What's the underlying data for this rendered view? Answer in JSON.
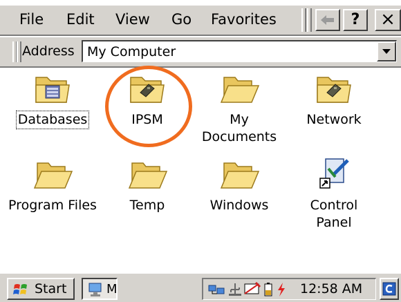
{
  "menu": {
    "file": "File",
    "edit": "Edit",
    "view": "View",
    "go": "Go",
    "favorites": "Favorites",
    "help": "?",
    "close": "×",
    "back_icon": "back-arrow-icon"
  },
  "address": {
    "label": "Address",
    "value": "My Computer"
  },
  "items": [
    {
      "label": "Databases",
      "icon": "folder-database-icon"
    },
    {
      "label": "IPSM",
      "icon": "folder-storage-card-icon"
    },
    {
      "label_line1": "My",
      "label_line2": "Documents",
      "icon": "folder-icon"
    },
    {
      "label": "Network",
      "icon": "folder-network-icon"
    },
    {
      "label": "Program Files",
      "icon": "folder-icon"
    },
    {
      "label": "Temp",
      "icon": "folder-icon"
    },
    {
      "label": "Windows",
      "icon": "folder-icon"
    },
    {
      "label_line1": "Control",
      "label_line2": "Panel",
      "icon": "control-panel-icon"
    }
  ],
  "taskbar": {
    "start_label": "Start",
    "task_label": "M",
    "clock": "12:58 AM"
  },
  "colors": {
    "chrome": "#d6d3ce",
    "highlight_circle": "#f06c1f",
    "folder_fill": "#f6dc84",
    "folder_stroke": "#b8942a"
  }
}
